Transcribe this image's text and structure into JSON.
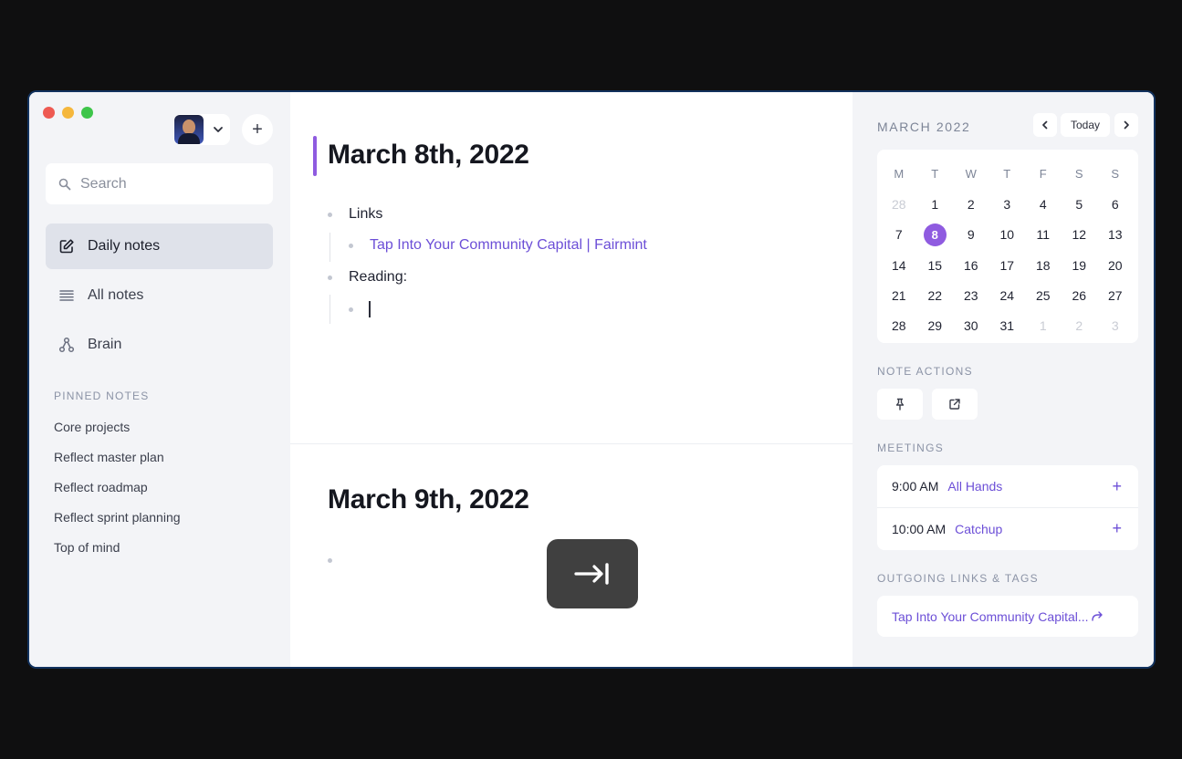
{
  "sidebar": {
    "traffic_colors": [
      "#ee5a52",
      "#f5b73c",
      "#3ec54a"
    ],
    "add_label": "+",
    "search_placeholder": "Search",
    "nav": [
      {
        "label": "Daily notes",
        "icon": "edit-icon",
        "active": true
      },
      {
        "label": "All notes",
        "icon": "list-icon",
        "active": false
      },
      {
        "label": "Brain",
        "icon": "graph-icon",
        "active": false
      }
    ],
    "pinned_title": "PINNED NOTES",
    "pinned": [
      "Core projects",
      "Reflect master plan",
      "Reflect roadmap",
      "Reflect sprint planning",
      "Top of mind"
    ]
  },
  "notes": [
    {
      "date": "March 8th, 2022",
      "items": [
        {
          "text": "Links",
          "children": [
            {
              "text": "Tap Into Your Community Capital | Fairmint",
              "link": true
            }
          ]
        },
        {
          "text": "Reading:",
          "children": [
            {
              "text": "",
              "cursor": true
            }
          ]
        }
      ]
    },
    {
      "date": "March 9th, 2022",
      "items": [
        {
          "text": ""
        }
      ]
    }
  ],
  "tab_overlay_icon": "tab-key-icon",
  "calendar": {
    "month": "MARCH 2022",
    "today_label": "Today",
    "weekdays": [
      "M",
      "T",
      "W",
      "T",
      "F",
      "S",
      "S"
    ],
    "days": [
      [
        "28",
        "1",
        "2",
        "3",
        "4",
        "5",
        "6"
      ],
      [
        "7",
        "8",
        "9",
        "10",
        "11",
        "12",
        "13"
      ],
      [
        "14",
        "15",
        "16",
        "17",
        "18",
        "19",
        "20"
      ],
      [
        "21",
        "22",
        "23",
        "24",
        "25",
        "26",
        "27"
      ],
      [
        "28",
        "29",
        "30",
        "31",
        "1",
        "2",
        "3"
      ]
    ],
    "selected_day": "8",
    "accent": "#8f5be0"
  },
  "note_actions": {
    "title": "NOTE ACTIONS",
    "buttons": [
      "pin-icon",
      "external-link-icon"
    ]
  },
  "meetings": {
    "title": "MEETINGS",
    "items": [
      {
        "time": "9:00 AM",
        "title": "All Hands"
      },
      {
        "time": "10:00 AM",
        "title": "Catchup"
      }
    ]
  },
  "outgoing": {
    "title": "OUTGOING LINKS & TAGS",
    "items": [
      "Tap Into Your Community Capital..."
    ]
  }
}
